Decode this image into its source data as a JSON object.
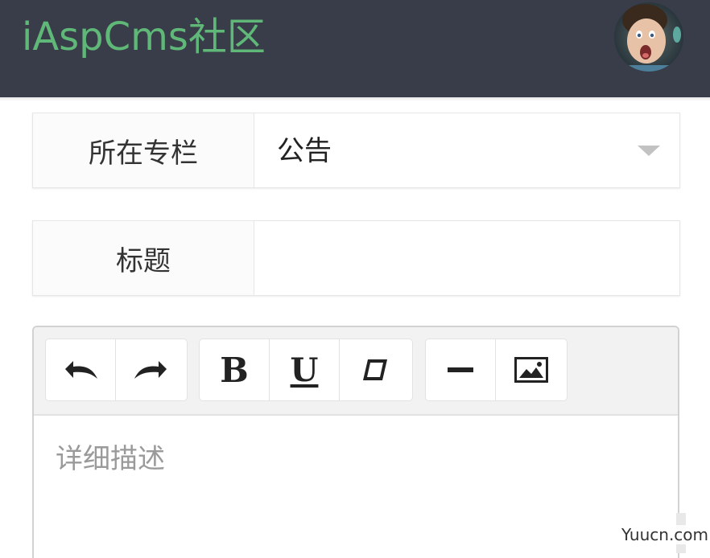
{
  "header": {
    "logo_text": "iAspCms社区",
    "logo_color": "#5fb878",
    "background_color": "#393d49",
    "avatar_icon": "user-avatar"
  },
  "form": {
    "column_label": "所在专栏",
    "column_value": "公告",
    "title_label": "标题",
    "title_value": ""
  },
  "editor": {
    "toolbar": {
      "undo_icon": "undo-icon",
      "redo_icon": "redo-icon",
      "bold_label": "B",
      "underline_label": "U",
      "clear_format_icon": "eraser-icon",
      "hr_icon": "horizontal-rule-icon",
      "image_icon": "image-icon"
    },
    "placeholder": "详细描述"
  },
  "watermark": "Yuucn.com"
}
